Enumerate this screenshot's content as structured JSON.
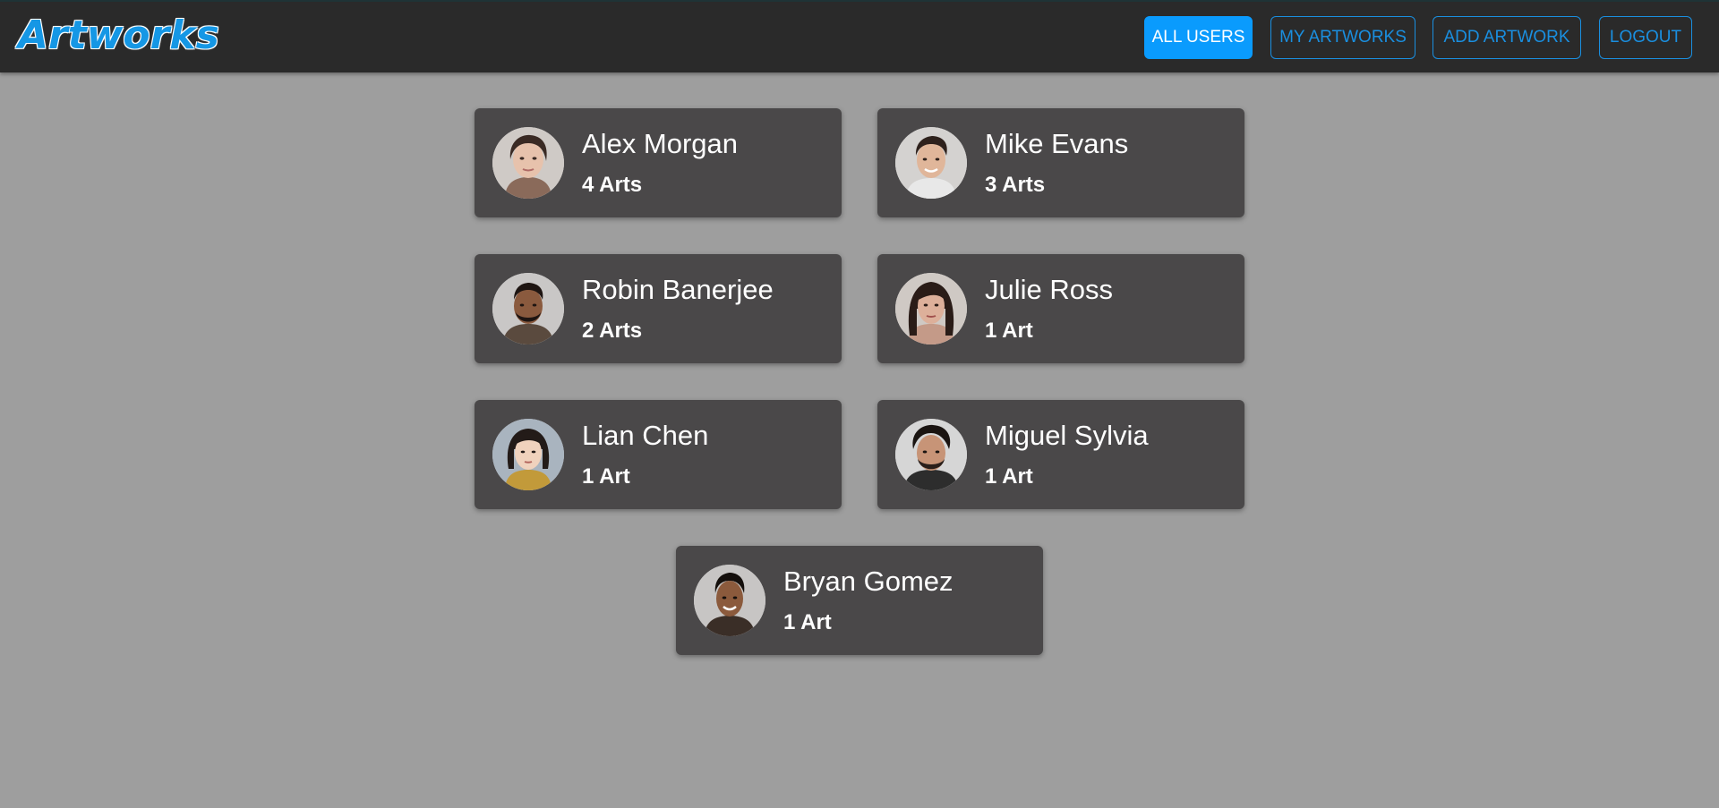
{
  "header": {
    "brand": "Artworks",
    "nav": {
      "all_users": "ALL USERS",
      "my_artworks": "MY ARTWORKS",
      "add_artwork": "ADD ARTWORK",
      "logout": "LOGOUT"
    },
    "active_nav": "all_users"
  },
  "colors": {
    "accent": "#0a9bfd",
    "page_background": "#9e9e9e",
    "navbar_background": "#2a2a2a",
    "card_background": "#4a4849",
    "text": "#ffffff"
  },
  "users": [
    {
      "name": "Alex Morgan",
      "arts": "4 Arts",
      "avatar": "woman-portrait-photo"
    },
    {
      "name": "Mike Evans",
      "arts": "3 Arts",
      "avatar": "man-portrait-photo"
    },
    {
      "name": "Robin Banerjee",
      "arts": "2 Arts",
      "avatar": "man-portrait-photo"
    },
    {
      "name": "Julie Ross",
      "arts": "1 Art",
      "avatar": "woman-portrait-photo"
    },
    {
      "name": "Lian Chen",
      "arts": "1 Art",
      "avatar": "woman-portrait-photo"
    },
    {
      "name": "Miguel Sylvia",
      "arts": "1 Art",
      "avatar": "man-portrait-photo"
    },
    {
      "name": "Bryan Gomez",
      "arts": "1 Art",
      "avatar": "man-portrait-photo"
    }
  ]
}
